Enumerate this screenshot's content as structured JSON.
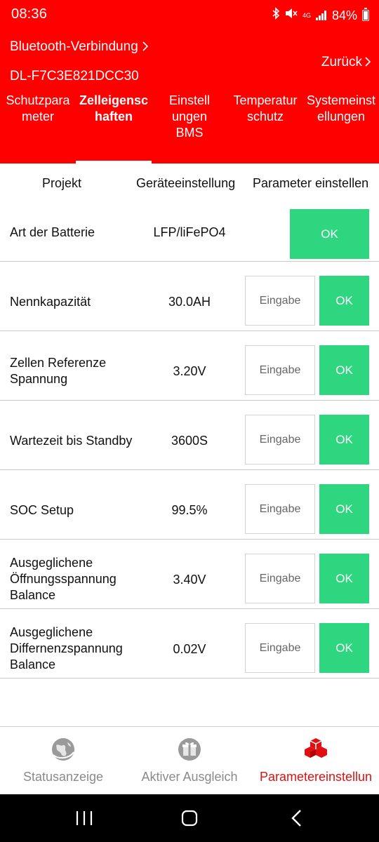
{
  "statusbar": {
    "time": "08:36",
    "network": "4G",
    "battery": "84%",
    "icons": [
      "bluetooth-icon",
      "mute-icon",
      "signal-icon",
      "battery-icon"
    ]
  },
  "header": {
    "bluetooth_link": "Bluetooth-Verbindung",
    "back": "Zurück",
    "device_id": "DL-F7C3E821DCC30"
  },
  "tabs": [
    {
      "line1": "Schutzpara",
      "line2": "meter",
      "line3": ""
    },
    {
      "line1": "Zelleigensc",
      "line2": "haften",
      "line3": "",
      "active": true
    },
    {
      "line1": "Einstell",
      "line2": "ungen",
      "line3": "BMS"
    },
    {
      "line1": "Temperatur",
      "line2": "schutz",
      "line3": ""
    },
    {
      "line1": "Systemeinst",
      "line2": "ellungen",
      "line3": ""
    }
  ],
  "columns": {
    "project": "Projekt",
    "device_setting": "Geräteeinstellung",
    "set_parameter": "Parameter einstellen"
  },
  "rows": [
    {
      "label": "Art der Batterie",
      "value": "LFP/liFePO4",
      "ok": "OK"
    },
    {
      "label": "Nennkapazität",
      "value": "30.0AH",
      "placeholder": "Eingabe",
      "ok": "OK"
    },
    {
      "label_l1": "Zellen Referenze",
      "label_l2": "Spannung",
      "value": "3.20V",
      "placeholder": "Eingabe",
      "ok": "OK"
    },
    {
      "label": "Wartezeit bis Standby",
      "value": "3600S",
      "placeholder": "Eingabe",
      "ok": "OK"
    },
    {
      "label": "SOC Setup",
      "value": "99.5%",
      "placeholder": "Eingabe",
      "ok": "OK"
    },
    {
      "label_l1": "Ausgeglichene",
      "label_l2": "Öffnungsspannung",
      "label_l3": "Balance",
      "value": "3.40V",
      "placeholder": "Eingabe",
      "ok": "OK"
    },
    {
      "label_l1": "Ausgeglichene",
      "label_l2": "Differnenzspannung",
      "label_l3": "Balance",
      "value": "0.02V",
      "placeholder": "Eingabe",
      "ok": "OK"
    }
  ],
  "bottomnav": [
    {
      "label": "Statusanzeige",
      "icon": "globe-icon"
    },
    {
      "label": "Aktiver Ausgleich",
      "icon": "gift-icon"
    },
    {
      "label": "Parametereinstellun",
      "icon": "cubes-icon",
      "active": true
    }
  ],
  "colors": {
    "header_red": "#ff0000",
    "ok_green": "#2fd680",
    "active_nav_red": "#e01010"
  }
}
